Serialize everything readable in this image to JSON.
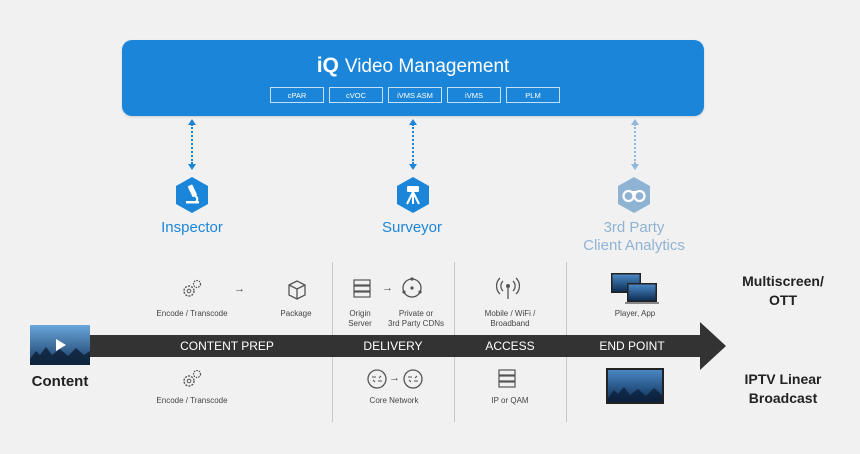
{
  "management": {
    "logo": "iQ",
    "title": "Video Management",
    "modules": [
      "cPAR",
      "cVOC",
      "iVMS ASM",
      "iVMS",
      "PLM"
    ]
  },
  "tools": {
    "inspector": {
      "label": "Inspector",
      "icon": "microscope-icon"
    },
    "surveyor": {
      "label": "Surveyor",
      "icon": "surveying-tripod-icon"
    },
    "third_party": {
      "label_line1": "3rd Party",
      "label_line2": "Client Analytics",
      "icon": "binoculars-icon"
    }
  },
  "stages": [
    "CONTENT PREP",
    "DELIVERY",
    "ACCESS",
    "END POINT"
  ],
  "top_row": {
    "encode": "Encode / Transcode",
    "package": "Package",
    "origin_line1": "Origin",
    "origin_line2": "Server",
    "cdn_line1": "Private or",
    "cdn_line2": "3rd Party CDNs",
    "access_line1": "Mobile / WiFi /",
    "access_line2": "Broadband",
    "endpoint": "Player, App"
  },
  "bottom_row": {
    "encode": "Encode / Transcode",
    "network": "Core Network",
    "access": "IP or QAM"
  },
  "labels": {
    "content": "Content",
    "ott_line1": "Multiscreen/",
    "ott_line2": "OTT",
    "iptv_line1": "IPTV Linear",
    "iptv_line2": "Broadcast"
  },
  "colors": {
    "brand_blue": "#1b86d9",
    "faded_blue": "#8fb3d3",
    "dark_band": "#333333"
  }
}
